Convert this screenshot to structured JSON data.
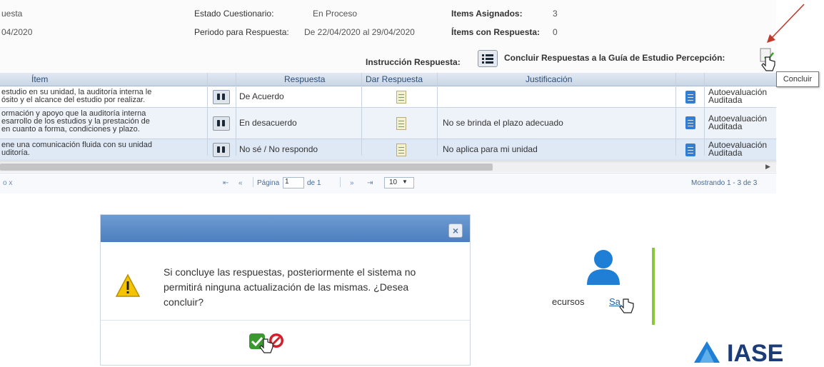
{
  "header": {
    "left_top": "uesta",
    "left_date": "04/2020",
    "estado_label": "Estado Cuestionario:",
    "estado_value": "En Proceso",
    "periodo_label": "Periodo para Respuesta:",
    "periodo_value": "De 22/04/2020 al 29/04/2020",
    "items_asignados_label": "Items Asignados:",
    "items_asignados_value": "3",
    "items_respuesta_label": "Ítems con Respuesta:",
    "items_respuesta_value": "0",
    "instruccion_label": "Instrucción Respuesta:",
    "concluir_label": "Concluir Respuestas a la Guía de Estudio Percepción:",
    "tooltip": "Concluir"
  },
  "grid": {
    "columns": [
      "Ítem",
      "Respuesta",
      "Dar Respuesta",
      "Justificación"
    ],
    "rows": [
      {
        "item_lines": [
          "estudio en su unidad, la auditoría interna le",
          "ósito y el alcance del estudio por realizar."
        ],
        "respuesta": "De Acuerdo",
        "justificacion": "",
        "tipo_lines": [
          "Autoevaluación",
          "Auditada"
        ]
      },
      {
        "item_lines": [
          "ormación y apoyo que la auditoría interna",
          "esarrollo de los estudios y la prestación de",
          "en cuanto a forma, condiciones y plazo."
        ],
        "respuesta": "En desacuerdo",
        "justificacion": "No se brinda el plazo adecuado",
        "tipo_lines": [
          "Autoevaluación",
          "Auditada"
        ]
      },
      {
        "item_lines": [
          "ene una comunicación fluida con su unidad",
          "uditoría."
        ],
        "respuesta": "No sé / No respondo",
        "justificacion": "No aplica para mi unidad",
        "tipo_lines": [
          "Autoevaluación",
          "Auditada"
        ]
      }
    ]
  },
  "pager": {
    "left_symbols": "o  x",
    "first": "⇤",
    "prev": "«",
    "page_label": "Página",
    "page_value": "1",
    "of_label": "de 1",
    "next": "»",
    "last": "⇥",
    "page_size": "10",
    "showing": "Mostrando 1 - 3 de 3"
  },
  "dialog": {
    "close_symbol": "×",
    "message_lines": [
      "Si concluye las respuestas, posteriormente el sistema no",
      "permitirá ninguna actualización de las mismas. ¿Desea",
      "concluir?"
    ]
  },
  "profile": {
    "recursos": "ecursos",
    "salir": "Sa"
  },
  "logo": {
    "text": "IASE"
  },
  "colors": {
    "accent_blue": "#4d7fbf",
    "header_blue": "#2c4d77",
    "confirm_green": "#3a9a2f",
    "cancel_red": "#d0202a",
    "profile_blue": "#1f7ed6",
    "profile_bar": "#8cc63f",
    "arrow_red": "#c0392b"
  }
}
